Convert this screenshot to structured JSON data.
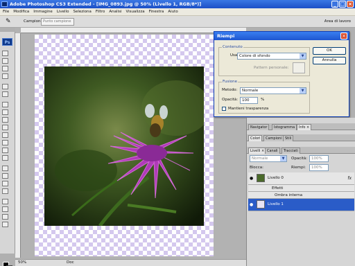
{
  "window": {
    "title": "Adobe Photoshop CS3 Extended - [IMG_0893.jpg @ 50% (Livello 1, RGB/8*)]"
  },
  "menu": [
    "File",
    "Modifica",
    "Immagine",
    "Livello",
    "Seleziona",
    "Filtro",
    "Analisi",
    "Visualizza",
    "Finestra",
    "Aiuto"
  ],
  "options": {
    "label": "Campione:",
    "value": "Punto campione",
    "workspace": "Area di lavoro"
  },
  "toolbox": {
    "badge": "Ps"
  },
  "status": {
    "zoom": "50%",
    "info": "Doc"
  },
  "dialog": {
    "title": "Riempi",
    "content_group": "Contenuto",
    "use_label": "Usa:",
    "use_value": "Colore di sfondo",
    "pattern_label": "Pattern personale:",
    "blend_group": "Fusione",
    "method_label": "Metodo:",
    "method_value": "Normale",
    "opacity_label": "Opacità:",
    "opacity_value": "100",
    "opacity_unit": "%",
    "preserve_label": "Mantieni trasparenza",
    "ok": "OK",
    "cancel": "Annulla"
  },
  "panels": {
    "tabs1": [
      "Navigator",
      "Istogramma",
      "Info ×"
    ],
    "tabs2": [
      "Colori",
      "Campioni",
      "Stili"
    ],
    "tabs3": [
      "Livelli ×",
      "Canali",
      "Tracciati"
    ],
    "blend_mode": "Normale",
    "opacity_label": "Opacità:",
    "opacity_value": "100%",
    "lock_label": "Blocca:",
    "fill_label": "Riempi:",
    "fill_value": "100%",
    "layers": [
      {
        "name": "Livello 0",
        "fx": "fx"
      },
      {
        "name": "Effetti"
      },
      {
        "name": "Ombra interna"
      },
      {
        "name": "Livello 1"
      }
    ]
  }
}
